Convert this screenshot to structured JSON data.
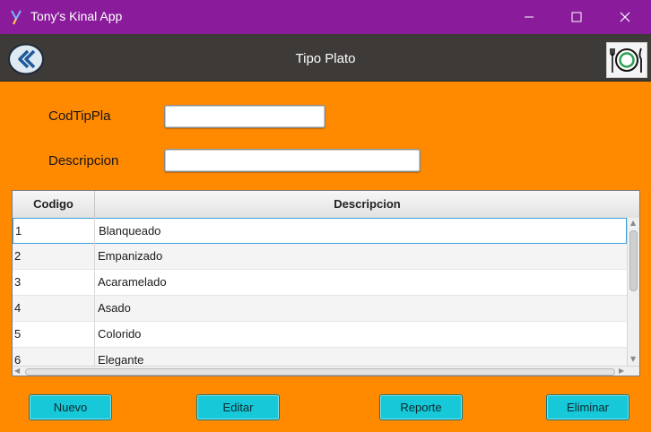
{
  "window": {
    "title": "Tony's Kinal App",
    "icons": {
      "app": "app-icon",
      "minimize": "minimize-icon",
      "maximize": "maximize-icon",
      "close": "close-icon"
    }
  },
  "header": {
    "title": "Tipo Plato",
    "back_icon": "double-chevron-left-icon",
    "logo_icon": "plate-cutlery-icon"
  },
  "form": {
    "cod_label": "CodTipPla",
    "cod_value": "",
    "desc_label": "Descripcion",
    "desc_value": ""
  },
  "table": {
    "columns": [
      "Codigo",
      "Descripcion"
    ],
    "rows": [
      {
        "codigo": "1",
        "descripcion": "Blanqueado"
      },
      {
        "codigo": "2",
        "descripcion": "Empanizado"
      },
      {
        "codigo": "3",
        "descripcion": "Acaramelado"
      },
      {
        "codigo": "4",
        "descripcion": "Asado"
      },
      {
        "codigo": "5",
        "descripcion": "Colorido"
      },
      {
        "codigo": "6",
        "descripcion": "Elegante"
      }
    ],
    "selected_row": 1
  },
  "buttons": {
    "nuevo": "Nuevo",
    "editar": "Editar",
    "reporte": "Reporte",
    "eliminar": "Eliminar"
  },
  "colors": {
    "titlebar": "#8a1c9c",
    "header": "#3d3a38",
    "background": "#ff8a00",
    "button": "#16c8d8"
  }
}
